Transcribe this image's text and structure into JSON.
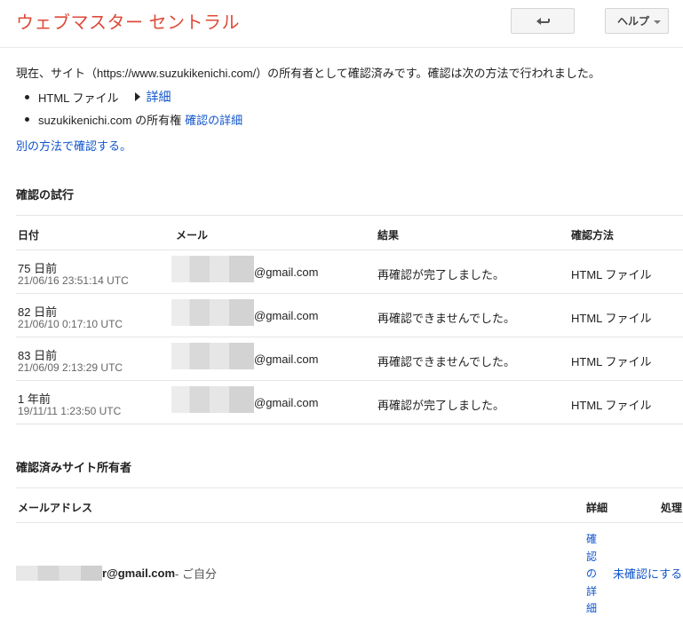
{
  "header": {
    "title": "ウェブマスター セントラル",
    "back_icon": "back-arrow-icon",
    "help_label": "ヘルプ"
  },
  "intro": {
    "text": "現在、サイト（https://www.suzukikenichi.com/）の所有者として確認済みです。確認は次の方法で行われました。",
    "bullets": [
      {
        "label": "HTML ファイル",
        "link": "詳細"
      },
      {
        "label": "suzukikenichi.com の所有権",
        "link": "確認の詳細"
      }
    ],
    "alt_method_link": "別の方法で確認する。"
  },
  "attempts": {
    "title": "確認の試行",
    "headers": {
      "date": "日付",
      "mail": "メール",
      "result": "結果",
      "method": "確認方法"
    },
    "rows": [
      {
        "ago": "75 日前",
        "timestamp": "21/06/16 23:51:14 UTC",
        "mail_suffix": "@gmail.com",
        "result": "再確認が完了しました。",
        "method": "HTML ファイル"
      },
      {
        "ago": "82 日前",
        "timestamp": "21/06/10 0:17:10 UTC",
        "mail_suffix": "@gmail.com",
        "result": "再確認できませんでした。",
        "method": "HTML ファイル"
      },
      {
        "ago": "83 日前",
        "timestamp": "21/06/09 2:13:29 UTC",
        "mail_suffix": "@gmail.com",
        "result": "再確認できませんでした。",
        "method": "HTML ファイル"
      },
      {
        "ago": "1 年前",
        "timestamp": "19/11/11 1:23:50 UTC",
        "mail_suffix": "@gmail.com",
        "result": "再確認が完了しました。",
        "method": "HTML ファイル"
      }
    ]
  },
  "owners": {
    "title": "確認済みサイト所有者",
    "headers": {
      "email": "メールアドレス",
      "details": "詳細",
      "action": "処理"
    },
    "rows": [
      {
        "email_suffix": "r@gmail.com",
        "self_label": " - ご自分",
        "details_link": "確認の詳細",
        "action_link": "未確認にする"
      }
    ]
  }
}
